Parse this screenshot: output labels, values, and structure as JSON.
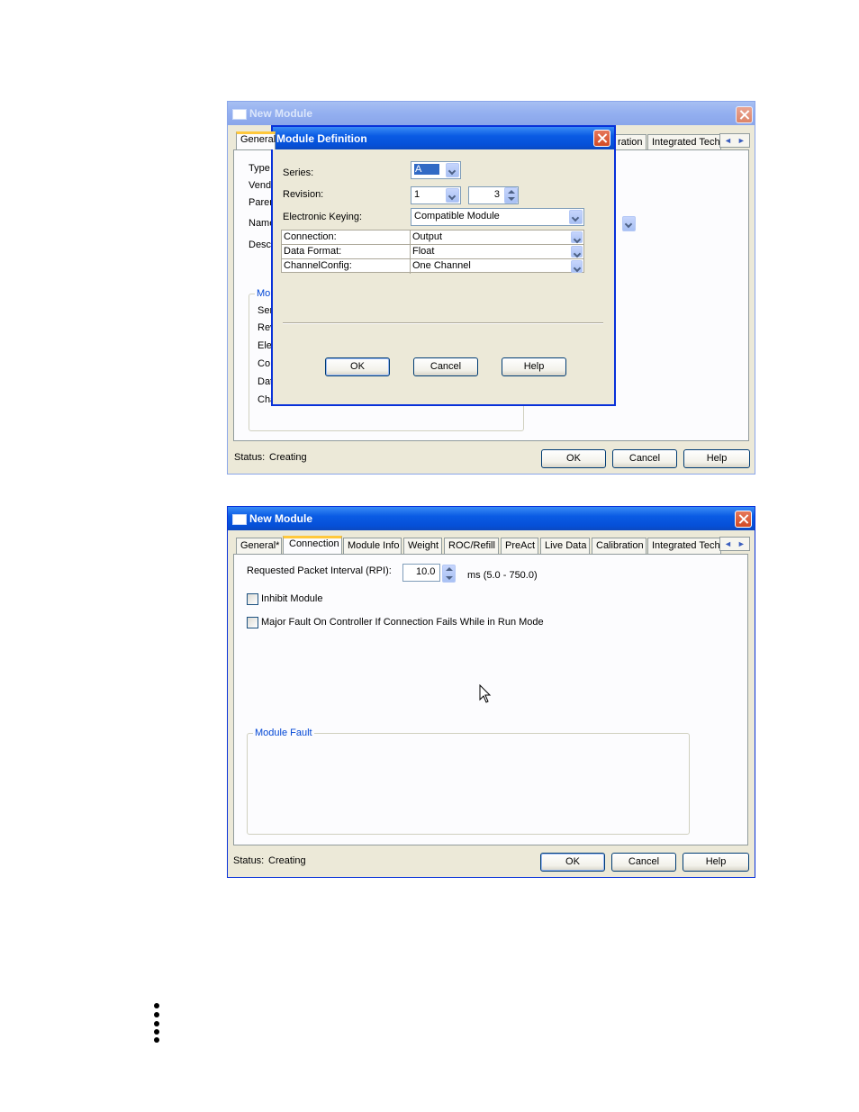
{
  "window1": {
    "title": "New Module",
    "tabs": [
      "General",
      "ration",
      "Integrated Tech"
    ],
    "background_labels": [
      "Type",
      "Vend",
      "Paren",
      "Name",
      "Desc"
    ],
    "background_group_title": "Mo",
    "background_group_labels": [
      "Ser",
      "Rev",
      "Ele",
      "Co",
      "Dat",
      "Cha"
    ],
    "status_label": "Status:",
    "status_value": "Creating",
    "ok": "OK",
    "cancel": "Cancel",
    "help": "Help"
  },
  "dialog": {
    "title": "Module Definition",
    "series_label": "Series:",
    "series_value": "A",
    "revision_label": "Revision:",
    "revision_major": "1",
    "revision_minor": "3",
    "keying_label": "Electronic Keying:",
    "keying_value": "Compatible Module",
    "grid": [
      {
        "label": "Connection:",
        "value": "Output"
      },
      {
        "label": "Data Format:",
        "value": "Float"
      },
      {
        "label": "ChannelConfig:",
        "value": "One Channel"
      }
    ],
    "ok": "OK",
    "cancel": "Cancel",
    "help": "Help"
  },
  "window2": {
    "title": "New Module",
    "tabs": [
      "General*",
      "Connection",
      "Module Info",
      "Weight",
      "ROC/Refill",
      "PreAct",
      "Live Data",
      "Calibration",
      "Integrated Tech"
    ],
    "rpi_label": "Requested Packet Interval (RPI):",
    "rpi_value": "10.0",
    "rpi_units": "ms (5.0 - 750.0)",
    "inhibit_label": "Inhibit Module",
    "majorfault_label": "Major Fault On Controller If Connection Fails While in Run Mode",
    "module_fault_title": "Module Fault",
    "status_label": "Status:",
    "status_value": "Creating",
    "ok": "OK",
    "cancel": "Cancel",
    "help": "Help"
  }
}
